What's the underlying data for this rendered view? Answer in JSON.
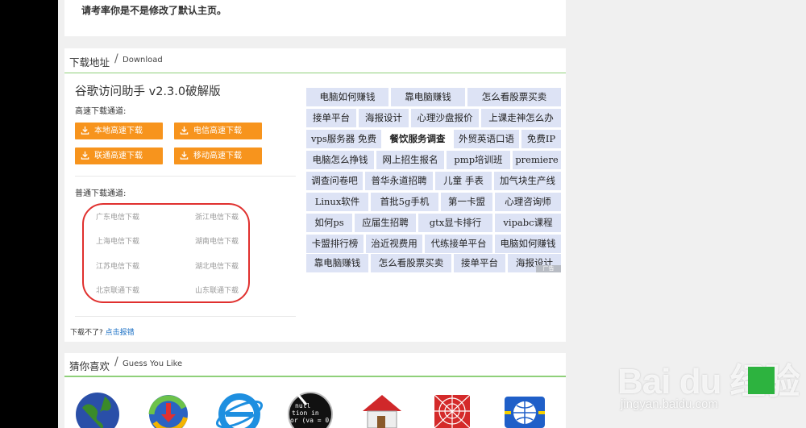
{
  "top": {
    "message": "请考率你是不是修改了默认主页。"
  },
  "download_section": {
    "title_cn": "下载地址",
    "separator": "/",
    "title_en": "Download",
    "app_name": "谷歌访问助手 v2.3.0破解版",
    "fast_label": "高速下载通道:",
    "fast_buttons": [
      "本地高速下载",
      "电信高速下载",
      "联通高速下载",
      "移动高速下载"
    ],
    "normal_label": "普通下载通道:",
    "mirrors": [
      "广东电信下载",
      "浙江电信下载",
      "上海电信下载",
      "湖南电信下载",
      "江苏电信下载",
      "湖北电信下载",
      "北京联通下载",
      "山东联通下载"
    ],
    "report_text": "下载不了?",
    "report_link": "点击报错"
  },
  "ads": {
    "rows": [
      [
        "电脑如何赚钱",
        "靠电脑赚钱",
        "怎么看股票买卖"
      ],
      [
        "接单平台",
        "海报设计",
        "心理沙盘报价",
        "上课走神怎么办"
      ],
      [
        "vps服务器 免费",
        "餐饮服务调查",
        "外贸英语口语",
        "免费IP"
      ],
      [
        "电脑怎么挣钱",
        "网上招生报名",
        "pmp培训班",
        "premiere"
      ],
      [
        "调查问卷吧",
        "普华永道招聘",
        "儿童 手表",
        "加气块生产线"
      ],
      [
        "Linux软件",
        "首批5g手机",
        "第一卡盟",
        "心理咨询师"
      ],
      [
        "如何ps",
        "应届生招聘",
        "gtx显卡排行",
        "vipabc课程"
      ],
      [
        "卡盟排行榜",
        "治近视费用",
        "代练接单平台",
        "电脑如何赚钱"
      ],
      [
        "靠电脑赚钱",
        "怎么看股票买卖",
        "接单平台",
        "海报设计"
      ]
    ],
    "highlighted": "餐饮服务调查",
    "ad_mark": "广告"
  },
  "guess_section": {
    "title_cn": "猜你喜欢",
    "separator": "/",
    "title_en": "Guess You Like",
    "icons": [
      "globe-icon",
      "download-manager-icon",
      "ie-browser-icon",
      "xmlhttp-code-icon",
      "house-icon",
      "spider-web-icon",
      "network-globe-icon"
    ]
  },
  "watermark": {
    "brand": "Bai du 经验",
    "url": "jingyan.baidu.com"
  },
  "colors": {
    "orange": "#f7941d",
    "green_line": "#8fd07a",
    "ad_bg": "#dde3f5",
    "red_oval": "#e0302e",
    "link_blue": "#1a6fc4"
  }
}
